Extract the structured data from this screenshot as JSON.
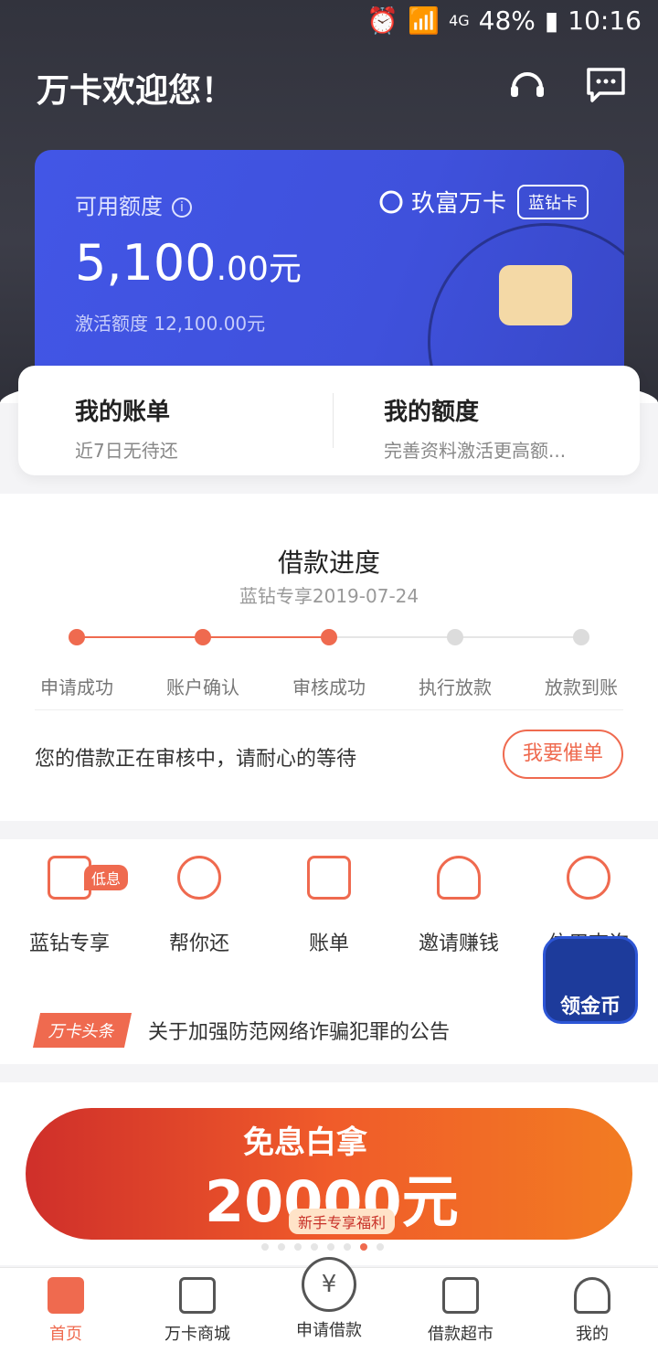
{
  "status_bar": {
    "battery": "48%",
    "time": "10:16",
    "network": "4G"
  },
  "header": {
    "title": "万卡欢迎您！",
    "icons": [
      "headset-icon",
      "message-icon"
    ]
  },
  "card": {
    "label": "可用额度",
    "amount_main": "5,100",
    "amount_decimal": ".00",
    "amount_unit": "元",
    "activation": "激活额度 12,100.00元",
    "brand": "玖富万卡",
    "badge": "蓝钻卡"
  },
  "quick": {
    "bill_title": "我的账单",
    "bill_sub": "近7日无待还",
    "limit_title": "我的额度",
    "limit_sub": "完善资料激活更高额..."
  },
  "progress": {
    "title": "借款进度",
    "date": "蓝钻专享2019-07-24",
    "steps": [
      "申请成功",
      "账户确认",
      "审核成功",
      "执行放款",
      "放款到账"
    ],
    "completed_steps": 3,
    "status_text": "您的借款正在审核中，请耐心的等待",
    "urge_button": "我要催单"
  },
  "functions": {
    "items": [
      "蓝钻专享",
      "帮你还",
      "账单",
      "邀请赚钱",
      "信用查询"
    ],
    "tag": "低息",
    "news_tag": "万卡头条",
    "news_text": "关于加强防范网络诈骗犯罪的公告"
  },
  "float": {
    "text": "领金币"
  },
  "banner": {
    "line1": "免息白拿",
    "line2": "20000元",
    "line3": "新手专享福利",
    "active_dot": 7
  },
  "tabs": [
    "首页",
    "万卡商城",
    "申请借款",
    "借款超市",
    "我的"
  ],
  "colors": {
    "accent": "#ef6a4f",
    "card": "#4256e6",
    "dark": "#32333d"
  }
}
